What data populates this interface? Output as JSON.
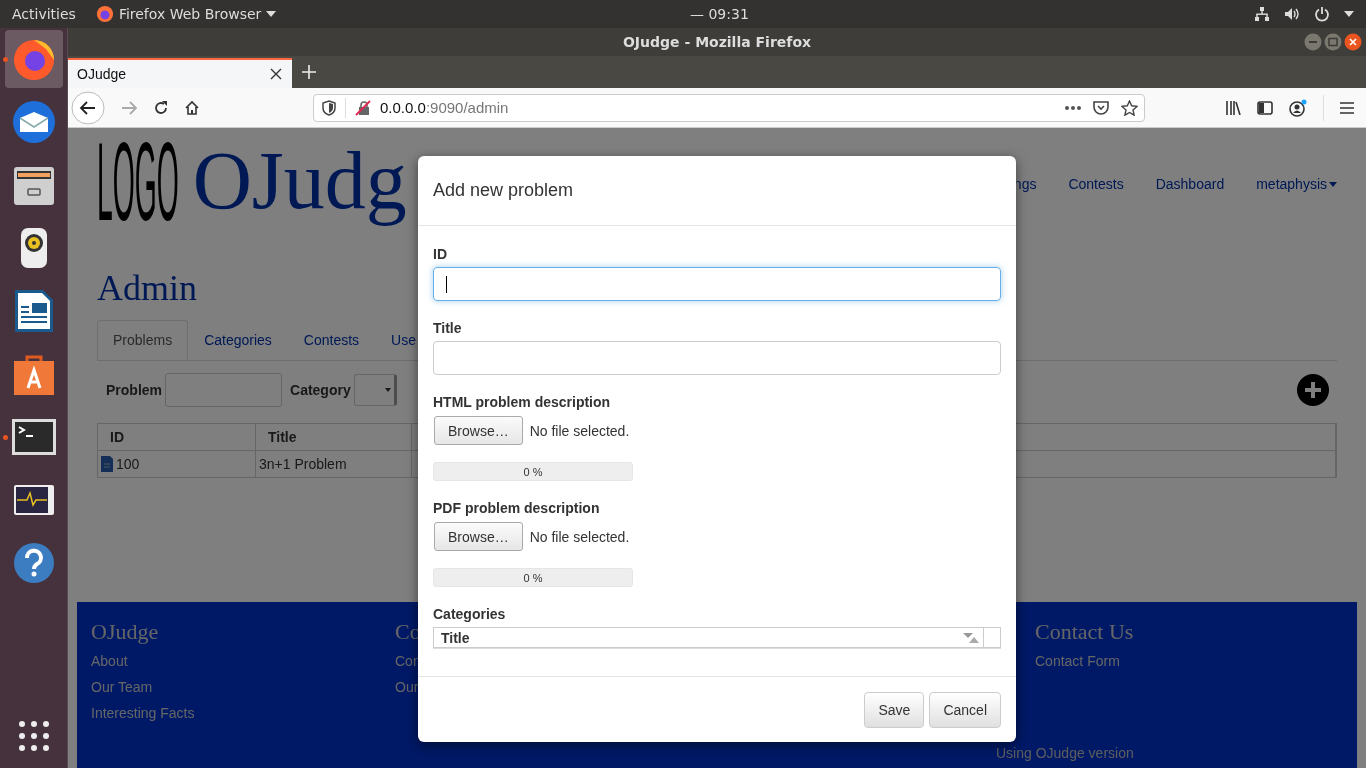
{
  "top_bar": {
    "activities": "Activities",
    "app_menu": "Firefox Web Browser",
    "clock_prefix": "—",
    "clock": "09:31"
  },
  "window": {
    "title": "OJudge - Mozilla Firefox"
  },
  "dock": [
    {
      "kind": "firefox",
      "running": true,
      "selected": true
    },
    {
      "kind": "mail",
      "running": false,
      "selected": false
    },
    {
      "kind": "files",
      "running": false,
      "selected": false
    },
    {
      "kind": "music",
      "running": false,
      "selected": false
    },
    {
      "kind": "writer",
      "running": false,
      "selected": false
    },
    {
      "kind": "store",
      "running": false,
      "selected": false
    },
    {
      "kind": "terminal",
      "running": true,
      "selected": false
    },
    {
      "kind": "monitor",
      "running": false,
      "selected": false
    },
    {
      "kind": "help",
      "running": false,
      "selected": false
    }
  ],
  "browser": {
    "tabs": [
      {
        "label": "OJudge",
        "selected": true
      }
    ],
    "url_host": "0.0.0.0",
    "url_path": ":9090/admin"
  },
  "page": {
    "logo": "LOGO",
    "brand": "OJudg",
    "nav": [
      "ngs",
      "Contests",
      "Dashboard"
    ],
    "user_menu": "metaphysis",
    "heading": "Admin",
    "tabs": [
      {
        "label": "Problems",
        "selected": true
      },
      {
        "label": "Categories",
        "selected": false
      },
      {
        "label": "Contests",
        "selected": false
      },
      {
        "label": "Use",
        "selected": false
      }
    ],
    "filters": {
      "problem_label": "Problem",
      "category_label": "Category"
    },
    "table": {
      "columns": [
        "ID",
        "Title"
      ],
      "rows": [
        {
          "id": "100",
          "title": "3n+1 Problem"
        }
      ]
    },
    "footer": {
      "columns": [
        {
          "heading": "OJudge",
          "links": [
            "About",
            "Our Team",
            "Interesting Facts"
          ]
        },
        {
          "heading": "Co",
          "links": [
            "Con",
            "Our"
          ]
        },
        {
          "heading": "Contact Us",
          "links": [
            "Contact Form"
          ]
        }
      ],
      "version_note": "Using OJudge version"
    }
  },
  "dialog": {
    "title": "Add new problem",
    "fields": [
      {
        "kind": "text",
        "label": "ID",
        "focused": true
      },
      {
        "kind": "text",
        "label": "Title",
        "focused": false
      },
      {
        "kind": "file",
        "label": "HTML problem description",
        "button": "Browse…",
        "status": "No file selected.",
        "progress": "0 %",
        "level": 0
      },
      {
        "kind": "file",
        "label": "PDF problem description",
        "button": "Browse…",
        "status": "No file selected.",
        "progress": "0 %",
        "level": 0
      },
      {
        "kind": "table",
        "label": "Categories",
        "columns": [
          "Title"
        ]
      }
    ],
    "buttons": [
      "Save",
      "Cancel"
    ]
  }
}
